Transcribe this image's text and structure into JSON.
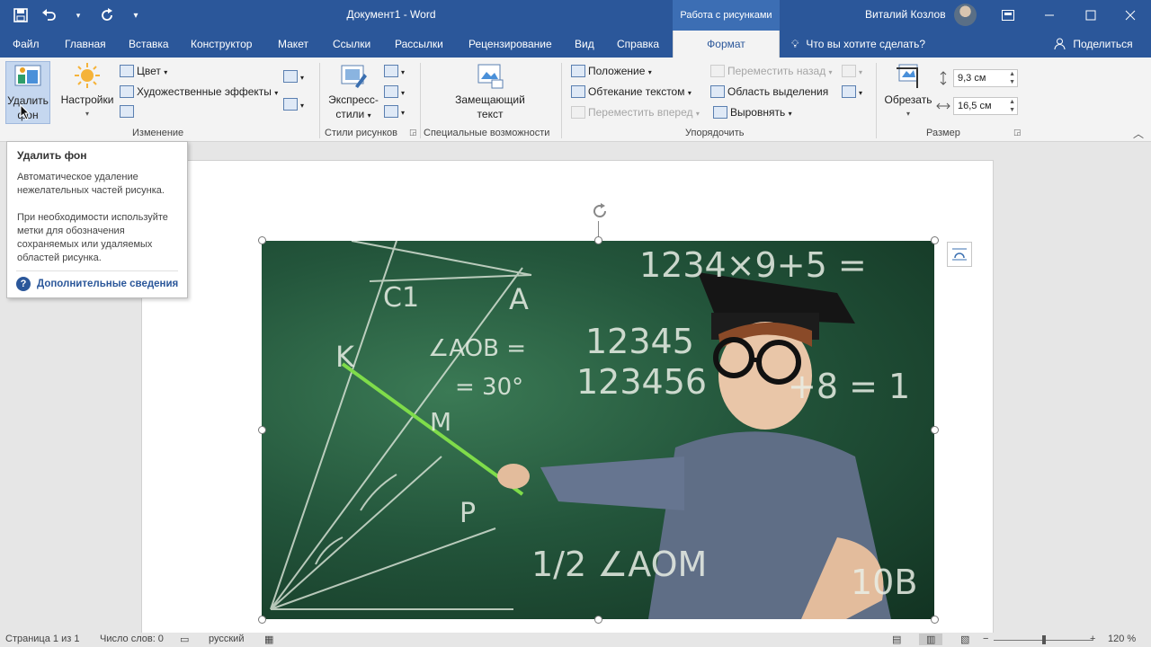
{
  "titlebar": {
    "document_title": "Документ1  -  Word",
    "context_group": "Работа с рисунками",
    "user_name": "Виталий Козлов",
    "qat": {
      "save": "save-icon",
      "undo": "undo-icon",
      "redo": "redo-icon",
      "customize": "customize-qat-icon"
    },
    "window_controls": {
      "ribbon_options": "ribbon-display-icon",
      "minimize": "minimize-icon",
      "maximize": "maximize-icon",
      "close": "close-icon"
    }
  },
  "tabs": [
    "Файл",
    "Главная",
    "Вставка",
    "Конструктор",
    "Макет",
    "Ссылки",
    "Рассылки",
    "Рецензирование",
    "Вид",
    "Справка",
    "Формат"
  ],
  "tell_me": "Что вы хотите сделать?",
  "share": "Поделиться",
  "ribbon": {
    "change": {
      "remove_bg_line1": "Удалить",
      "remove_bg_line2": "фон",
      "corrections": "Настройки",
      "color": "Цвет",
      "artistic": "Художественные эффекты",
      "label": "Изменение"
    },
    "styles": {
      "express_line1": "Экспресс-",
      "express_line2": "стили",
      "label": "Стили рисунков"
    },
    "accessibility": {
      "alt_line1": "Замещающий",
      "alt_line2": "текст",
      "label": "Специальные возможности"
    },
    "arrange": {
      "position": "Положение",
      "wrap": "Обтекание текстом",
      "forward": "Переместить вперед",
      "backward": "Переместить назад",
      "selection": "Область выделения",
      "align": "Выровнять",
      "label": "Упорядочить"
    },
    "size": {
      "crop": "Обрезать",
      "height": "9,3 см",
      "width": "16,5 см",
      "label": "Размер"
    }
  },
  "tooltip": {
    "title": "Удалить фон",
    "p1": "Автоматическое удаление нежелательных частей рисунка.",
    "p2": "При необходимости используйте метки для обозначения сохраняемых или удаляемых областей рисунка.",
    "link": "Дополнительные сведения"
  },
  "picture": {
    "chalk": {
      "c1": "C1",
      "a": "A",
      "k": "K",
      "angle1": "∠AOB =",
      "angle2": "= 30°",
      "m": "M",
      "p": "P",
      "row1": "1234×9+5 =",
      "row2": "12345",
      "row3": "123456",
      "row4": "+8 = 1",
      "frac": "1/2 ∠AOM",
      "nob": "10B"
    }
  },
  "statusbar": {
    "page": "Страница 1 из 1",
    "words": "Число слов: 0",
    "language": "русский",
    "zoom": "120 %"
  }
}
